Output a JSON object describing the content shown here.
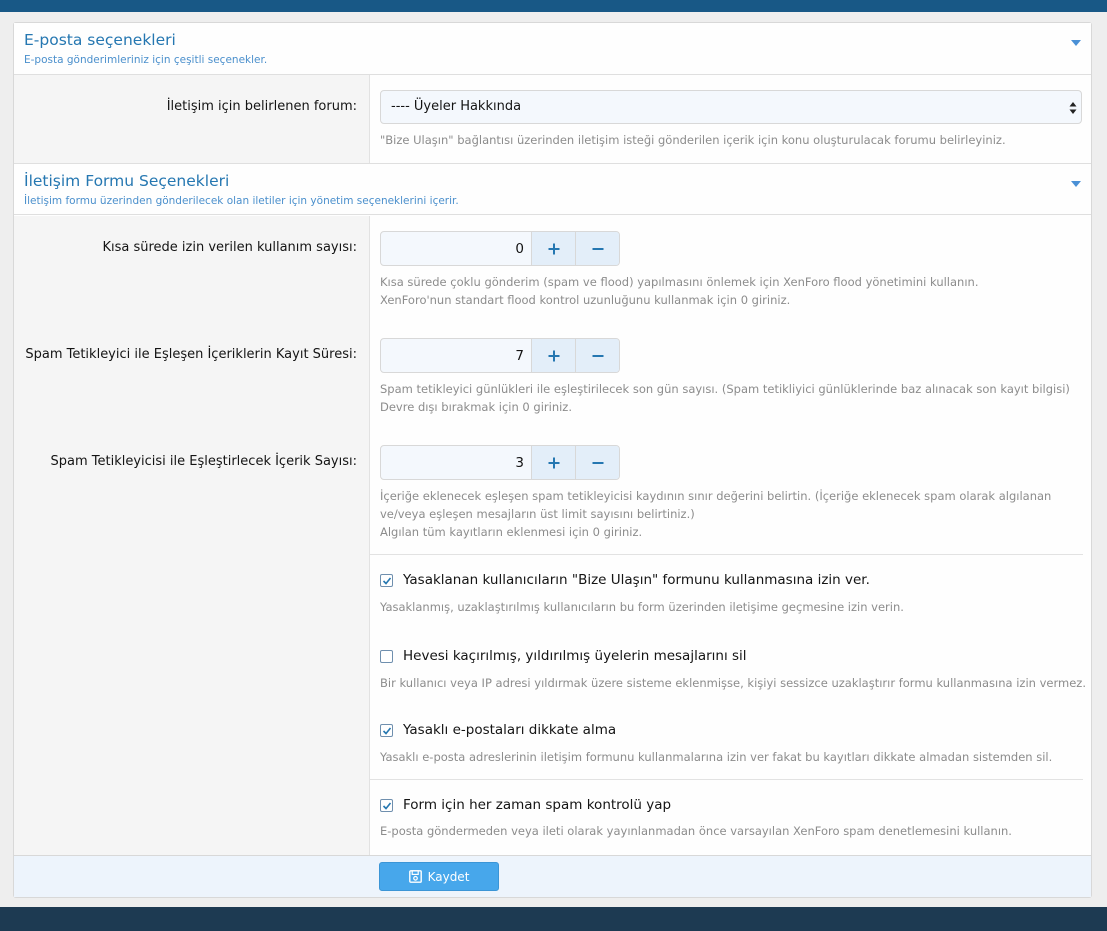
{
  "colors": {
    "top_bar": "#185886",
    "bottom_bar": "#1d3a52",
    "title": "#2577b1",
    "accent_button": "#47a7eb"
  },
  "email_section": {
    "title": "E-posta seçenekleri",
    "description": "E-posta gönderimleriniz için çeşitli seçenekler.",
    "collapse_icon": "chevron-down-icon",
    "forum_label": "İletişim için belirlenen forum:",
    "forum_value": "---- Üyeler Hakkında",
    "forum_hint": "\"Bize Ulaşın\" bağlantısı üzerinden iletişim isteği gönderilen içerik için konu oluşturulacak forumu belirleyiniz."
  },
  "contact_section": {
    "title": "İletişim Formu Seçenekleri",
    "description": "İletişim formu üzerinden gönderilecek olan iletiler için yönetim seçeneklerini içerir.",
    "collapse_icon": "chevron-down-icon",
    "flood": {
      "label": "Kısa sürede izin verilen kullanım sayısı:",
      "value": "0",
      "hint1": "Kısa sürede çoklu gönderim (spam ve flood) yapılmasını önlemek için XenForo flood yönetimini kullanın.",
      "hint2": "XenForo'nun standart flood kontrol uzunluğunu kullanmak için 0 giriniz."
    },
    "spam_log_days": {
      "label": "Spam Tetikleyici ile Eşleşen İçeriklerin Kayıt Süresi:",
      "value": "7",
      "hint1": "Spam tetikleyici günlükleri ile eşleştirilecek son gün sayısı. (Spam tetikliyici günlüklerinde baz alınacak son kayıt bilgisi)",
      "hint2": "Devre dışı bırakmak için 0 giriniz."
    },
    "spam_match_count": {
      "label": "Spam Tetikleyicisi ile Eşleştirlecek İçerik Sayısı:",
      "value": "3",
      "hint1": "İçeriğe eklenecek eşleşen spam tetikleyicisi kaydının sınır değerini belirtin. (İçeriğe eklenecek spam olarak algılanan",
      "hint2": "ve/veya eşleşen mesajların üst limit sayısını belirtiniz.)",
      "hint3": "Algılan tüm kayıtların eklenmesi için 0 giriniz."
    },
    "options": [
      {
        "label": "Yasaklanan kullanıcıların \"Bize Ulaşın\" formunu kullanmasına izin ver.",
        "checked": true,
        "hint": "Yasaklanmış, uzaklaştırılmış kullanıcıların bu form üzerinden iletişime geçmesine izin verin."
      },
      {
        "label": "Hevesi kaçırılmış, yıldırılmış üyelerin mesajlarını sil",
        "checked": false,
        "hint": "Bir kullanıcı veya IP adresi yıldırmak üzere sisteme eklenmişse, kişiyi sessizce uzaklaştırır formu kullanmasına izin vermez."
      },
      {
        "label": "Yasaklı e-postaları dikkate alma",
        "checked": true,
        "hint": "Yasaklı e-posta adreslerinin iletişim formunu kullanmalarına izin ver fakat bu kayıtları dikkate almadan sistemden sil."
      },
      {
        "label": "Form için her zaman spam kontrolü yap",
        "checked": true,
        "hint": "E-posta göndermeden veya ileti olarak yayınlanmadan önce varsayılan XenForo spam denetlemesini kullanın."
      }
    ]
  },
  "footer": {
    "save_label": "Kaydet",
    "save_icon": "floppy-disk-icon"
  }
}
